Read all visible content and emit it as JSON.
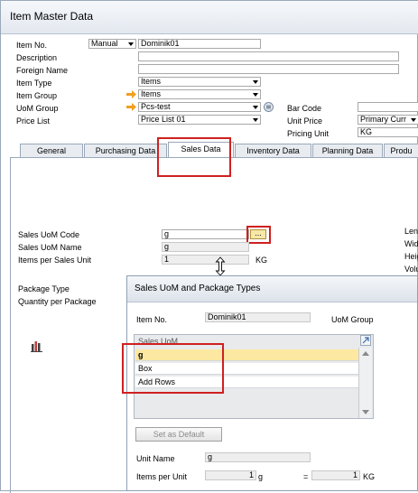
{
  "window": {
    "title": "Item Master Data"
  },
  "header": {
    "item_no_label": "Item No.",
    "numbering": "Manual",
    "item_no_value": "Dominik01",
    "description_label": "Description",
    "foreign_name_label": "Foreign Name",
    "item_type_label": "Item Type",
    "item_type_value": "Items",
    "item_group_label": "Item Group",
    "item_group_value": "Items",
    "uom_group_label": "UoM Group",
    "uom_group_value": "Pcs-test",
    "price_list_label": "Price List",
    "price_list_value": "Price List 01",
    "bar_code_label": "Bar Code",
    "unit_price_label": "Unit Price",
    "unit_price_currency": "Primary Curr",
    "pricing_unit_label": "Pricing Unit",
    "pricing_unit_value": "KG"
  },
  "tabs": [
    "General",
    "Purchasing Data",
    "Sales Data",
    "Inventory Data",
    "Planning Data",
    "Produ"
  ],
  "sales": {
    "uom_code_label": "Sales UoM Code",
    "uom_code_value": "g",
    "browse_label": "...",
    "uom_name_label": "Sales UoM Name",
    "uom_name_value": "g",
    "items_per_unit_label": "Items per Sales Unit",
    "items_per_unit_value": "1",
    "items_per_unit_unit": "KG",
    "package_type_label": "Package Type",
    "qty_per_package_label": "Quantity per Package",
    "right_labels": [
      "Len",
      "Wid",
      "Heig",
      "Volu"
    ]
  },
  "dialog": {
    "title": "Sales UoM and Package Types",
    "item_no_label": "Item No.",
    "item_no_value": "Dominik01",
    "uom_group_label": "UoM Group",
    "grid_header": "Sales UoM",
    "rows": [
      "g",
      "Box",
      "Add Rows"
    ],
    "set_default_label": "Set as Default",
    "unit_name_label": "Unit Name",
    "unit_name_value": "g",
    "items_per_unit_label": "Items per Unit",
    "items_per_unit_value": "1",
    "items_per_unit_uom": "g",
    "equals": "=",
    "base_qty_value": "1",
    "base_uom": "KG"
  },
  "colors": {
    "highlight_red": "#d02020",
    "selected_row": "#fce8a0",
    "link_arrow": "#f0a020"
  }
}
